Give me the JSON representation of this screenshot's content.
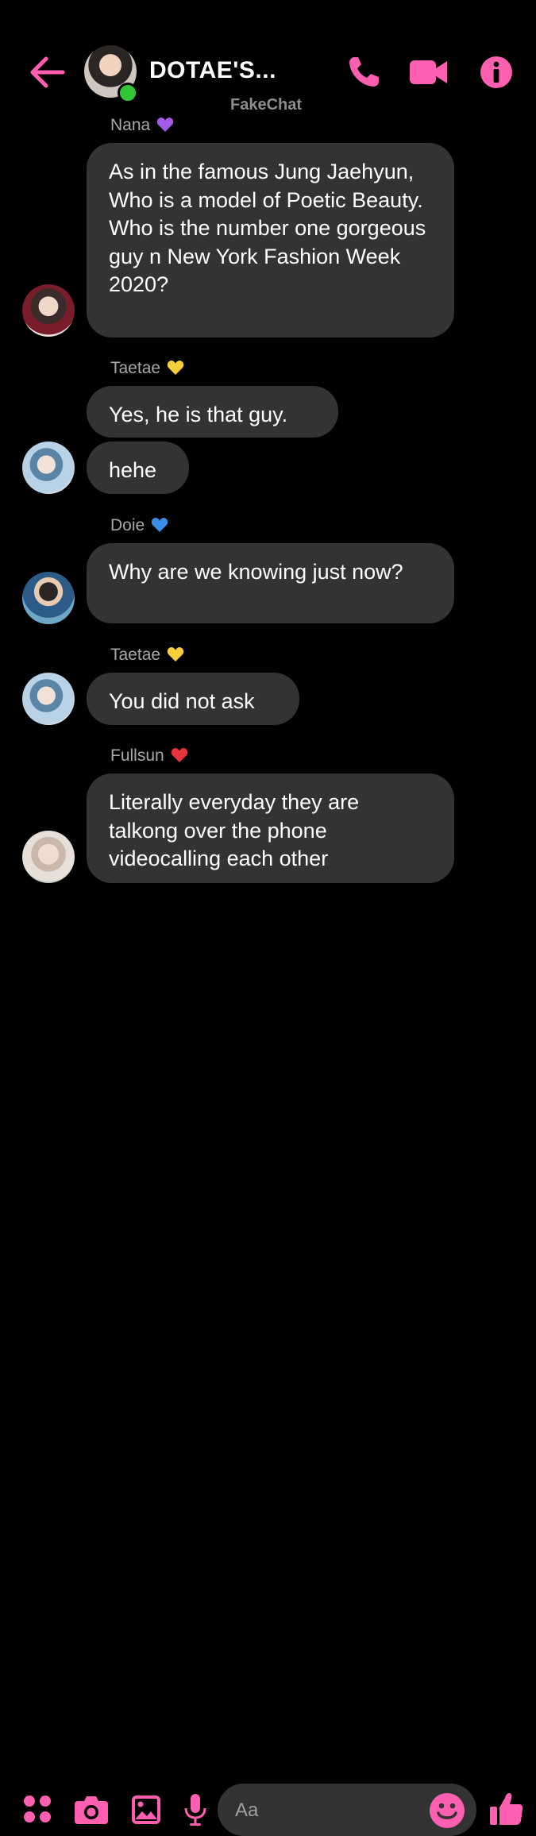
{
  "header": {
    "title": "DOTAE'S...",
    "watermark": "FakeChat",
    "accent_color": "#ff5fb0",
    "icons": [
      "back-arrow-icon",
      "phone-icon",
      "video-camera-icon",
      "info-icon"
    ]
  },
  "messages": [
    {
      "sender": "Nana",
      "heart": "purple-heart-icon",
      "text": "As in the famous Jung Jaehyun, Who is a model of Poetic Beauty. Who is the number one gorgeous guy n New York Fashion Week 2020?"
    },
    {
      "sender": "Taetae",
      "heart": "yellow-heart-icon",
      "text": "Yes, he is that guy."
    },
    {
      "sender": "",
      "text": "hehe"
    },
    {
      "sender": "Doie",
      "heart": "blue-heart-icon",
      "text": "Why are we knowing just now?"
    },
    {
      "sender": "Taetae",
      "heart": "yellow-heart-icon",
      "text": "You did not ask"
    },
    {
      "sender": "Fullsun",
      "heart": "red-heart-icon",
      "text": "Literally everyday they are talkong over the phone videocalling each other"
    }
  ],
  "composer": {
    "placeholder": "Aa",
    "icons": [
      "apps-icon",
      "camera-icon",
      "gallery-icon",
      "microphone-icon",
      "emoji-icon",
      "thumbs-up-icon"
    ]
  }
}
